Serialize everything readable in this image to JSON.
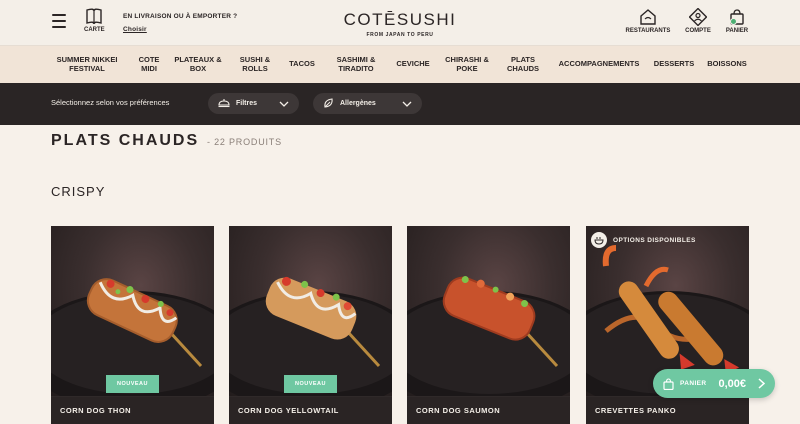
{
  "header": {
    "menu_icon": "hamburger-icon",
    "carte_label": "CARTE",
    "delivery_text": "EN LIVRAISON OU À EMPORTER ?",
    "delivery_link": "Choisir",
    "logo_text": "COTĒSUSHI",
    "logo_tagline": "FROM JAPAN TO PERU",
    "restaurants_label": "RESTAURANTS",
    "account_label": "COMPTE",
    "cart_label": "PANIER"
  },
  "nav": {
    "items": [
      "SUMMER NIKKEI FESTIVAL",
      "COTE MIDI",
      "PLATEAUX & BOX",
      "SUSHI & ROLLS",
      "TACOS",
      "SASHIMI & TIRADITO",
      "CEVICHE",
      "CHIRASHI & POKE",
      "PLATS CHAUDS",
      "ACCOMPAGNEMENTS",
      "DESSERTS",
      "BOISSONS"
    ]
  },
  "filters": {
    "prompt": "Sélectionnez selon vos préférences",
    "filter_label": "Filtres",
    "allergen_label": "Allergènes"
  },
  "main": {
    "title": "PLATS CHAUDS",
    "count": "- 22 PRODUITS",
    "section": "CRISPY",
    "products": [
      {
        "name": "CORN DOG THON",
        "badge": "NOUVEAU"
      },
      {
        "name": "CORN DOG YELLOWTAIL",
        "badge": "NOUVEAU"
      },
      {
        "name": "CORN DOG SAUMON"
      },
      {
        "name": "CREVETTES PANKO",
        "options": "OPTIONS DISPONIBLES"
      }
    ]
  },
  "cart_button": {
    "label": "PANIER",
    "amount": "0,00€"
  },
  "colors": {
    "accent_green": "#6fc8a2",
    "dark": "#2a2525",
    "nav_bg": "#f1e4d7",
    "page_bg": "#f7f1ea"
  }
}
